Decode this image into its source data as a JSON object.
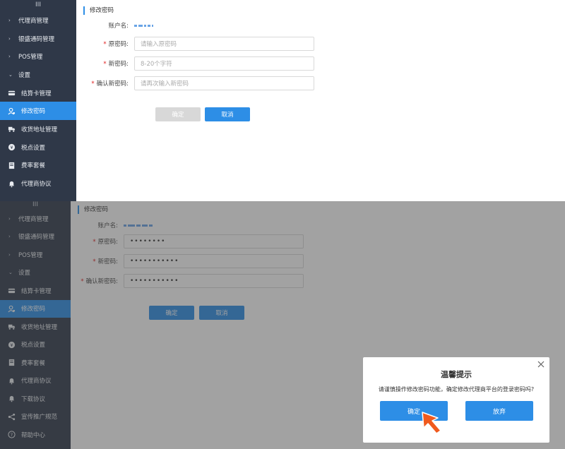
{
  "sidebar": {
    "hamburger_glyph": "III",
    "items": [
      {
        "label": "代理商管理",
        "type": "group",
        "caret": "›"
      },
      {
        "label": "银盛通码管理",
        "type": "group",
        "caret": "›"
      },
      {
        "label": "POS管理",
        "type": "group",
        "caret": "›"
      },
      {
        "label": "设置",
        "type": "group",
        "caret": "⌄"
      },
      {
        "label": "结算卡管理",
        "type": "item",
        "icon": "card-icon"
      },
      {
        "label": "修改密码",
        "type": "item",
        "icon": "user-key-icon",
        "active": true
      },
      {
        "label": "收货地址管理",
        "type": "item",
        "icon": "truck-icon"
      },
      {
        "label": "税点设置",
        "type": "item",
        "icon": "tax-icon"
      },
      {
        "label": "费率套餐",
        "type": "item",
        "icon": "package-icon"
      },
      {
        "label": "代理商协议",
        "type": "item",
        "icon": "bell-icon"
      },
      {
        "label": "下载协议",
        "type": "item",
        "icon": "bell-icon"
      },
      {
        "label": "宣传推广规范",
        "type": "item",
        "icon": "share-icon"
      },
      {
        "label": "帮助中心",
        "type": "item",
        "icon": "help-icon"
      }
    ]
  },
  "form": {
    "section_title": "修改密码",
    "account_label": "账户名:",
    "old_password_label": "原密码:",
    "new_password_label": "新密码:",
    "confirm_password_label": "确认新密码:",
    "required_mark": "*",
    "old_password_placeholder": "请输入原密码",
    "new_password_placeholder": "8-20个字符",
    "confirm_password_placeholder": "请再次输入新密码",
    "old_password_filled": "••••••••",
    "new_password_filled": "•••••••••••",
    "confirm_password_filled": "•••••••••••",
    "confirm_button": "确定",
    "cancel_button": "取消"
  },
  "dialog": {
    "title": "温馨提示",
    "message": "请谨慎操作修改密码功能，确定修改代理商平台的登录密码吗?",
    "ok_button": "确定",
    "cancel_button": "放弃",
    "close_glyph": "×"
  },
  "colors": {
    "accent": "#2d8ee6",
    "sidebar_bg": "#2f3848",
    "required": "#e02020",
    "pointer": "#f05a1e"
  }
}
